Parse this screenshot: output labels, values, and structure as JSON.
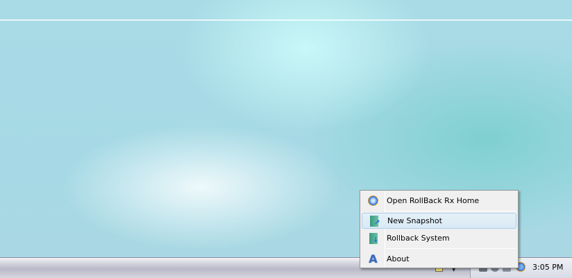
{
  "menu": {
    "items": [
      {
        "label": "Open RollBack Rx Home",
        "icon": "rollback-globe-icon"
      },
      {
        "label": "New Snapshot",
        "icon": "snapshot-door-icon",
        "highlighted": true
      },
      {
        "label": "Rollback System",
        "icon": "rollback-door-icon"
      },
      {
        "label": "About",
        "icon": "about-a-icon"
      }
    ]
  },
  "tray": {
    "clock": "3:05 PM"
  }
}
